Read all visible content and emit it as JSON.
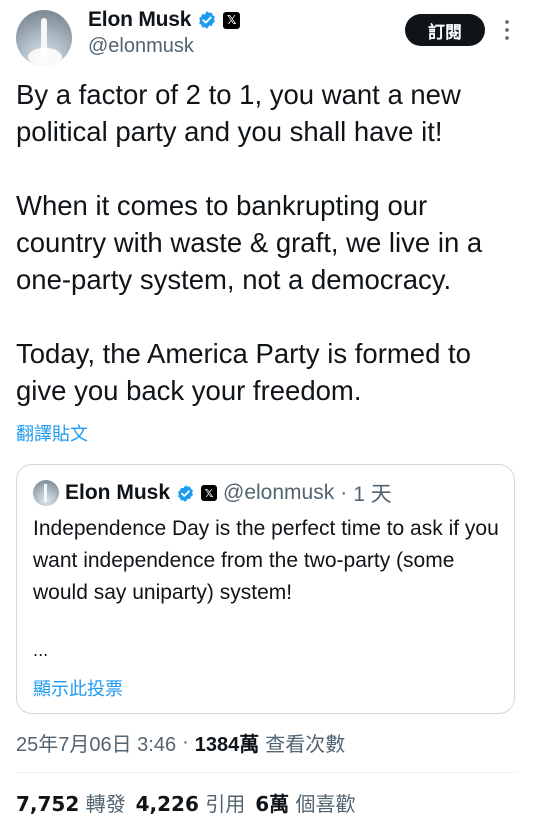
{
  "author": {
    "name": "Elon Musk",
    "handle": "@elonmusk",
    "subscribe_label": "訂閱",
    "more_label": "⋮",
    "x_logo_text": "𝕏"
  },
  "tweet": {
    "paragraphs": [
      "By a factor of 2 to 1, you want a new political party and you shall have it!",
      "When it comes to bankrupting our country with waste & graft, we live in a one-party system, not a democracy.",
      "Today, the America Party is formed to give you back your freedom."
    ],
    "translate_label": "翻譯貼文"
  },
  "quoted": {
    "name": "Elon Musk",
    "handle": "@elonmusk",
    "separator": "·",
    "time": "1 天",
    "text": "Independence Day is the perfect time to ask if you want independence from the two-party (some would say uniparty) system!",
    "ellipsis": "...",
    "poll_label": "顯示此投票"
  },
  "meta": {
    "date": "25年7月06日 3:46",
    "separator": "·",
    "views_count": "1384萬",
    "views_label": "查看次數"
  },
  "stats": [
    {
      "count": "7,752",
      "label": "轉發"
    },
    {
      "count": "4,226",
      "label": "引用"
    },
    {
      "count": "6萬",
      "label": "個喜歡"
    }
  ],
  "colors": {
    "accent": "#1d9bf0",
    "text": "#0f1419",
    "secondary": "#536471",
    "border": "#cfd9de",
    "verified": "#1d9bf0"
  }
}
